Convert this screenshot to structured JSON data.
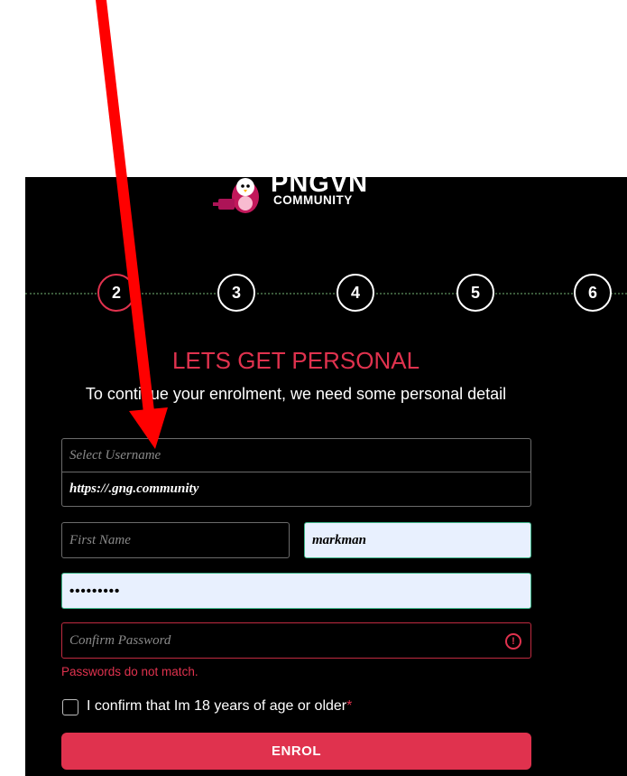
{
  "brand": {
    "name": "PNGVN",
    "tagline": "COMMUNITY"
  },
  "steps": [
    "2",
    "3",
    "4",
    "5",
    "6"
  ],
  "active_step": "2",
  "form": {
    "title": "LETS GET PERSONAL",
    "subtitle": "To continue your enrolment, we need some personal detail",
    "username_placeholder": "Select Username",
    "domain_suffix": "https://.gng.community",
    "first_name_placeholder": "First Name",
    "last_name_value": "markman",
    "password_value": "•••••••••",
    "confirm_password_placeholder": "Confirm Password",
    "error_message": "Passwords do not match.",
    "age_confirm_label": "I confirm that Im 18 years of age or older",
    "required_marker": "*",
    "submit_label": "ENROL"
  },
  "colors": {
    "accent": "#e0324e",
    "background": "#000000",
    "autofill": "#e8f0fe",
    "annotation_arrow": "#ff0000"
  },
  "annotation": {
    "type": "red-arrow",
    "target": "username-field"
  }
}
